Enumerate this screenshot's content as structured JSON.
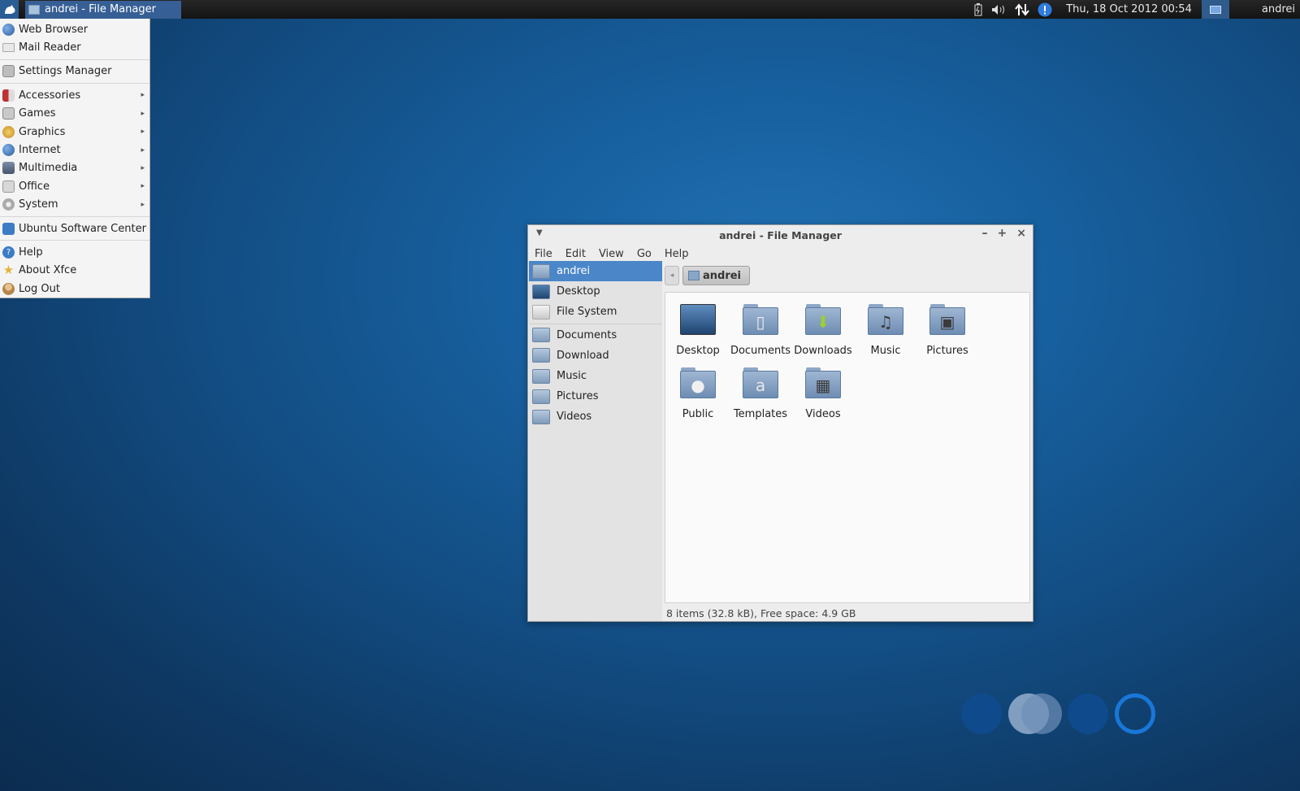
{
  "panel": {
    "task_label": "andrei - File Manager",
    "clock": "Thu, 18 Oct 2012 00:54",
    "user": "andrei",
    "icons": [
      "xfce-mouse-icon",
      "battery-icon",
      "volume-icon",
      "network-icon",
      "notification-icon",
      "workspace-icon"
    ]
  },
  "app_menu": {
    "items": [
      {
        "label": "Web Browser",
        "icon": "globe-icon",
        "color": "#3d6fb5"
      },
      {
        "label": "Mail Reader",
        "icon": "mail-icon",
        "color": "#bdbdbd"
      },
      {
        "label": "Settings Manager",
        "icon": "settings-icon",
        "color": "#9a9a9a"
      },
      {
        "label": "Accessories",
        "icon": "accessories-icon",
        "color": "#c03030",
        "submenu": true
      },
      {
        "label": "Games",
        "icon": "games-icon",
        "color": "#8a8a8a",
        "submenu": true
      },
      {
        "label": "Graphics",
        "icon": "graphics-icon",
        "color": "#d9a233",
        "submenu": true
      },
      {
        "label": "Internet",
        "icon": "globe-icon",
        "color": "#3d6fb5",
        "submenu": true
      },
      {
        "label": "Multimedia",
        "icon": "multimedia-icon",
        "color": "#5a6e8f",
        "submenu": true
      },
      {
        "label": "Office",
        "icon": "office-icon",
        "color": "#a9a9a9",
        "submenu": true
      },
      {
        "label": "System",
        "icon": "system-icon",
        "color": "#9c9c9c",
        "submenu": true
      },
      {
        "label": "Ubuntu Software Center",
        "icon": "software-center-icon",
        "color": "#3c7cc4"
      },
      {
        "label": "Help",
        "icon": "help-icon",
        "color": "#3c7cc4"
      },
      {
        "label": "About Xfce",
        "icon": "star-icon",
        "color": "#e0b23a"
      },
      {
        "label": "Log Out",
        "icon": "logout-icon",
        "color": "#c49a5d"
      }
    ]
  },
  "window": {
    "title": "andrei - File Manager",
    "menubar": [
      "File",
      "Edit",
      "View",
      "Go",
      "Help"
    ],
    "sidebar": [
      {
        "label": "andrei",
        "selected": true
      },
      {
        "label": "Desktop"
      },
      {
        "label": "File System"
      },
      {
        "label": "Documents"
      },
      {
        "label": "Download"
      },
      {
        "label": "Music"
      },
      {
        "label": "Pictures"
      },
      {
        "label": "Videos"
      }
    ],
    "pathbar": {
      "current": "andrei"
    },
    "files": [
      {
        "label": "Desktop",
        "glyph": ""
      },
      {
        "label": "Documents",
        "glyph": "▯"
      },
      {
        "label": "Downloads",
        "glyph": "⬇"
      },
      {
        "label": "Music",
        "glyph": "♫"
      },
      {
        "label": "Pictures",
        "glyph": "▣"
      },
      {
        "label": "Public",
        "glyph": "●"
      },
      {
        "label": "Templates",
        "glyph": "a"
      },
      {
        "label": "Videos",
        "glyph": "▦"
      }
    ],
    "status": "8 items (32.8 kB), Free space: 4.9 GB"
  },
  "colors": {
    "accent": "#4b86c9",
    "panel": "#1c1c1c",
    "desktop": "#17609f"
  }
}
